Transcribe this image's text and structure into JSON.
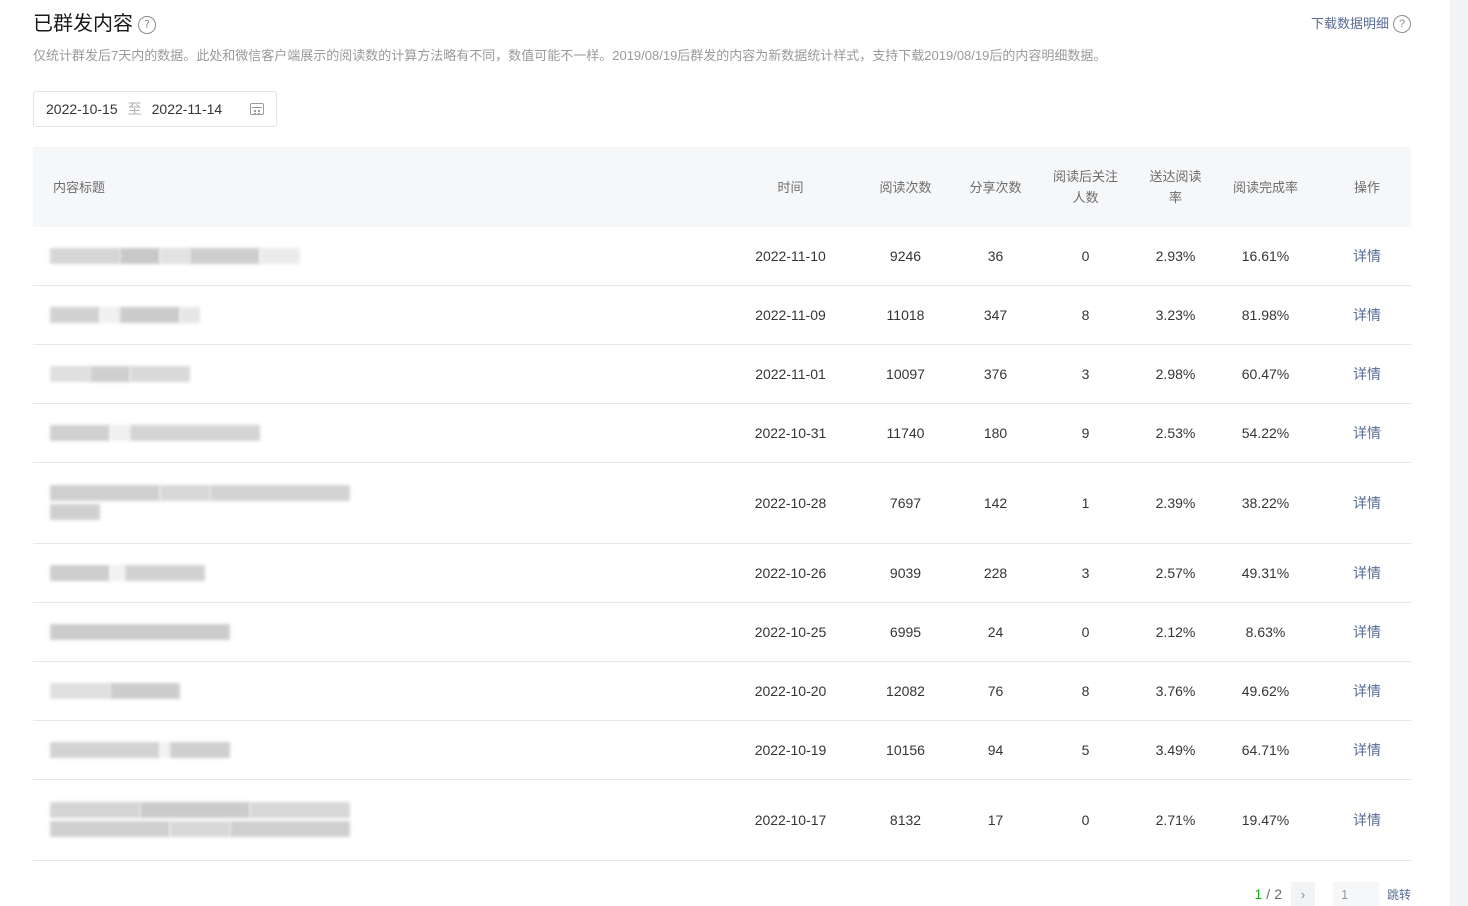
{
  "header": {
    "title": "已群发内容",
    "title_help": "?",
    "download_label": "下载数据明细",
    "download_help": "?",
    "description": "仅统计群发后7天内的数据。此处和微信客户端展示的阅读数的计算方法略有不同，数值可能不一样。2019/08/19后群发的内容为新数据统计样式，支持下载2019/08/19后的内容明细数据。"
  },
  "date_range": {
    "start": "2022-10-15",
    "separator": "至",
    "end": "2022-11-14"
  },
  "table": {
    "columns": {
      "title": "内容标题",
      "time": "时间",
      "reads": "阅读次数",
      "shares": "分享次数",
      "follows_line1": "阅读后关注",
      "follows_line2": "人数",
      "delivery_rate": "送达阅读率",
      "completion_rate": "阅读完成率",
      "action": "操作"
    },
    "rows": [
      {
        "time": "2022-11-10",
        "reads": "9246",
        "shares": "36",
        "follows": "0",
        "delivery_rate": "2.93%",
        "completion_rate": "16.61%",
        "action": "详情"
      },
      {
        "time": "2022-11-09",
        "reads": "11018",
        "shares": "347",
        "follows": "8",
        "delivery_rate": "3.23%",
        "completion_rate": "81.98%",
        "action": "详情"
      },
      {
        "time": "2022-11-01",
        "reads": "10097",
        "shares": "376",
        "follows": "3",
        "delivery_rate": "2.98%",
        "completion_rate": "60.47%",
        "action": "详情"
      },
      {
        "time": "2022-10-31",
        "reads": "11740",
        "shares": "180",
        "follows": "9",
        "delivery_rate": "2.53%",
        "completion_rate": "54.22%",
        "action": "详情"
      },
      {
        "time": "2022-10-28",
        "reads": "7697",
        "shares": "142",
        "follows": "1",
        "delivery_rate": "2.39%",
        "completion_rate": "38.22%",
        "action": "详情"
      },
      {
        "time": "2022-10-26",
        "reads": "9039",
        "shares": "228",
        "follows": "3",
        "delivery_rate": "2.57%",
        "completion_rate": "49.31%",
        "action": "详情"
      },
      {
        "time": "2022-10-25",
        "reads": "6995",
        "shares": "24",
        "follows": "0",
        "delivery_rate": "2.12%",
        "completion_rate": "8.63%",
        "action": "详情"
      },
      {
        "time": "2022-10-20",
        "reads": "12082",
        "shares": "76",
        "follows": "8",
        "delivery_rate": "3.76%",
        "completion_rate": "49.62%",
        "action": "详情"
      },
      {
        "time": "2022-10-19",
        "reads": "10156",
        "shares": "94",
        "follows": "5",
        "delivery_rate": "3.49%",
        "completion_rate": "64.71%",
        "action": "详情"
      },
      {
        "time": "2022-10-17",
        "reads": "8132",
        "shares": "17",
        "follows": "0",
        "delivery_rate": "2.71%",
        "completion_rate": "19.47%",
        "action": "详情"
      }
    ]
  },
  "pagination": {
    "current": "1",
    "separator": "/",
    "total": "2",
    "next_icon": "chevron-right-icon",
    "input_value": "1",
    "jump_label": "跳转"
  },
  "colors": {
    "link": "#576b95",
    "current_page": "#1aad19",
    "header_bg": "#f6f7f9",
    "row_border": "#e7e7eb"
  }
}
